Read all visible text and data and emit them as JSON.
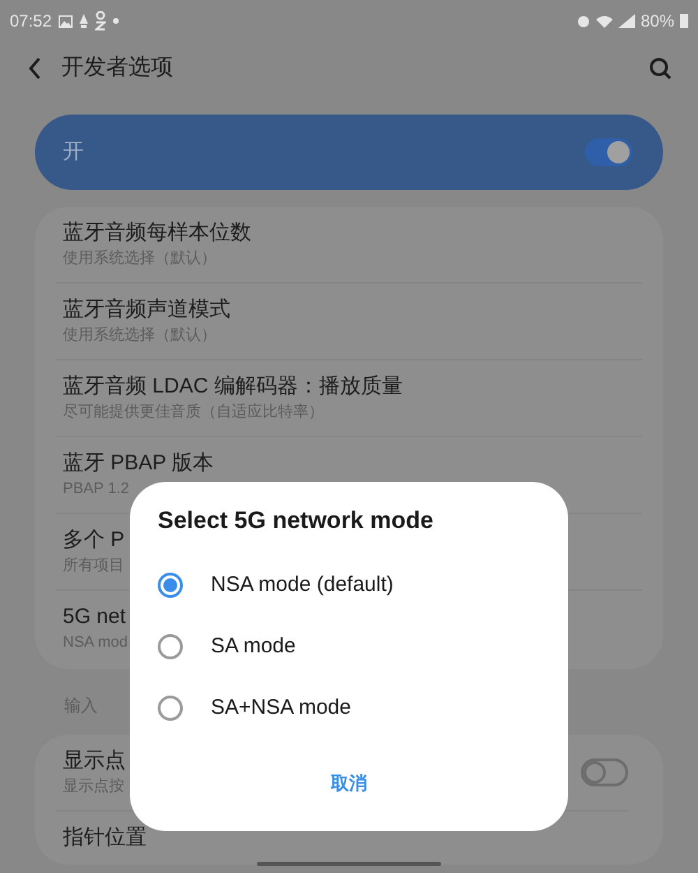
{
  "status_bar": {
    "time": "07:52",
    "battery": "80%"
  },
  "header": {
    "title": "开发者选项"
  },
  "master_switch": {
    "label": "开",
    "on": true
  },
  "settings": [
    {
      "title": "蓝牙音频每样本位数",
      "subtitle": "使用系统选择（默认）"
    },
    {
      "title": "蓝牙音频声道模式",
      "subtitle": "使用系统选择（默认）"
    },
    {
      "title": "蓝牙音频 LDAC 编解码器：播放质量",
      "subtitle": "尽可能提供更佳音质（自适应比特率）"
    },
    {
      "title": "蓝牙 PBAP 版本",
      "subtitle": "PBAP 1.2"
    },
    {
      "title": "多个 P",
      "subtitle": "所有项目"
    },
    {
      "title": "5G net",
      "subtitle": "NSA mod"
    }
  ],
  "section_input": {
    "label": "输入",
    "items": [
      {
        "title": "显示点",
        "subtitle": "显示点按",
        "kind": "toggle",
        "on": false
      },
      {
        "title": "指针位置",
        "kind": "plain"
      }
    ]
  },
  "dialog": {
    "title": "Select 5G network mode",
    "options": [
      {
        "label": "NSA mode (default)",
        "selected": true
      },
      {
        "label": "SA mode",
        "selected": false
      },
      {
        "label": "SA+NSA mode",
        "selected": false
      }
    ],
    "cancel": "取消"
  }
}
